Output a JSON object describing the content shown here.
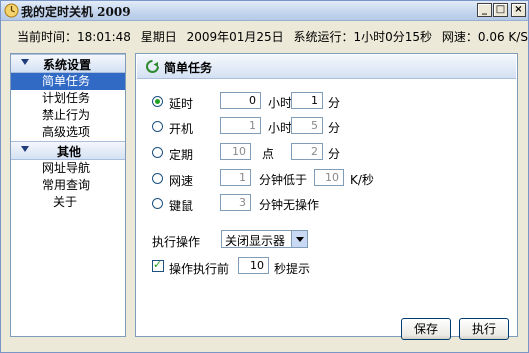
{
  "window": {
    "title": "我的定时关机  2009",
    "controls": {
      "minimize": "_",
      "maximize": "□",
      "close": "×"
    }
  },
  "status": {
    "current_time": "当前时间：18:01:48",
    "weekday": "星期日",
    "date": "2009年01月25日",
    "uptime": "系统运行：1小时0分15秒",
    "netspeed": "网速：0.06 K/S"
  },
  "sidebar": {
    "sections": [
      {
        "title": "系统设置",
        "items": [
          "简单任务",
          "计划任务",
          "禁止行为",
          "高级选项"
        ]
      },
      {
        "title": "其他",
        "items": [
          "网址导航",
          "常用查询",
          "关于"
        ]
      }
    ],
    "active_item": "简单任务"
  },
  "main": {
    "title": "简单任务",
    "options": [
      {
        "label": "延时",
        "checked": true,
        "field1": "0",
        "unit1": "小时",
        "field2": "1",
        "unit2": "分"
      },
      {
        "label": "开机",
        "checked": false,
        "field1": "1",
        "unit1": "小时",
        "field2": "5",
        "unit2": "分"
      },
      {
        "label": "定期",
        "checked": false,
        "field1": "10",
        "unit1": "点",
        "field2": "2",
        "unit2": "分"
      },
      {
        "label": "网速",
        "checked": false,
        "field1": "1",
        "unit1": "分钟低于",
        "field2": "10",
        "unit2": "K/秒"
      },
      {
        "label": "键鼠",
        "checked": false,
        "field1": "3",
        "unit1": "分钟无操作"
      }
    ],
    "action_label": "执行操作",
    "action_value": "关闭显示器",
    "prompt_checkbox_label": "操作执行前",
    "prompt_checked": true,
    "prompt_seconds": "10",
    "prompt_suffix": "秒提示"
  },
  "buttons": {
    "save": "保存",
    "execute": "执行"
  },
  "icons": [
    "app-icon",
    "refresh-icon",
    "collapse-triangle-icon"
  ]
}
